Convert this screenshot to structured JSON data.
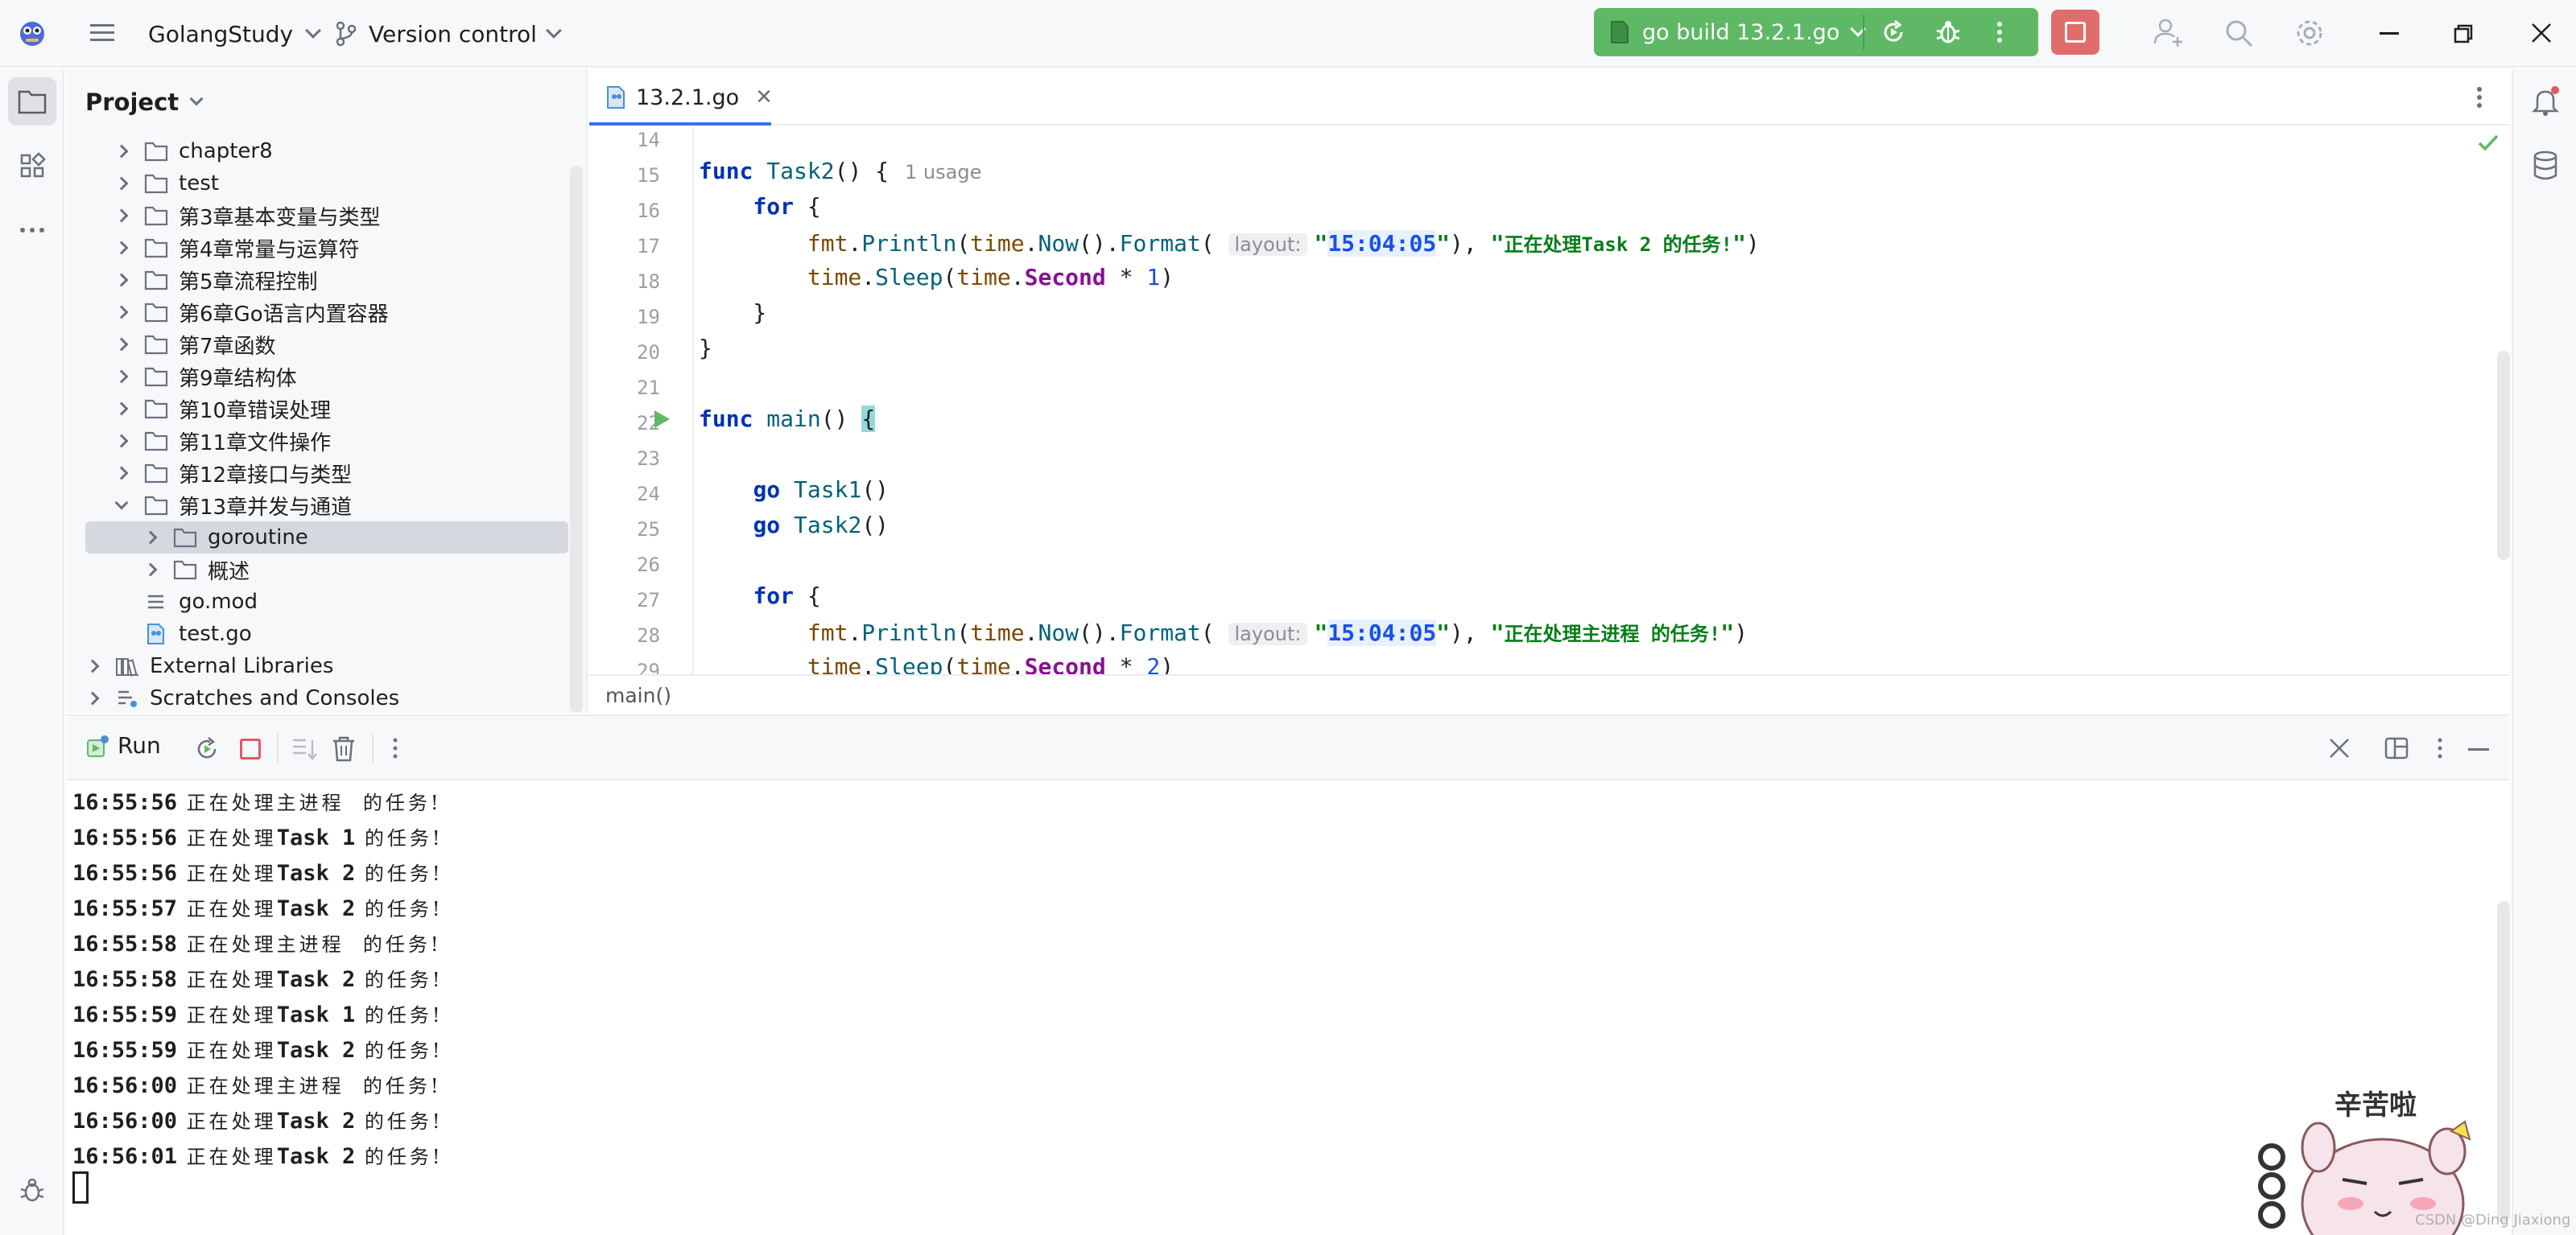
{
  "titlebar": {
    "project_name": "GolangStudy",
    "vcs_label": "Version control",
    "run_config": "go build 13.2.1.go"
  },
  "project_panel": {
    "title": "Project",
    "items": [
      {
        "label": "chapter8",
        "kind": "folder",
        "level": 1,
        "expanded": false
      },
      {
        "label": "test",
        "kind": "folder",
        "level": 1,
        "expanded": false
      },
      {
        "label": "第3章基本变量与类型",
        "kind": "folder",
        "level": 1,
        "expanded": false
      },
      {
        "label": "第4章常量与运算符",
        "kind": "folder",
        "level": 1,
        "expanded": false
      },
      {
        "label": "第5章流程控制",
        "kind": "folder",
        "level": 1,
        "expanded": false
      },
      {
        "label": "第6章Go语言内置容器",
        "kind": "folder",
        "level": 1,
        "expanded": false
      },
      {
        "label": "第7章函数",
        "kind": "folder",
        "level": 1,
        "expanded": false
      },
      {
        "label": "第9章结构体",
        "kind": "folder",
        "level": 1,
        "expanded": false
      },
      {
        "label": "第10章错误处理",
        "kind": "folder",
        "level": 1,
        "expanded": false
      },
      {
        "label": "第11章文件操作",
        "kind": "folder",
        "level": 1,
        "expanded": false
      },
      {
        "label": "第12章接口与类型",
        "kind": "folder",
        "level": 1,
        "expanded": false
      },
      {
        "label": "第13章并发与通道",
        "kind": "folder",
        "level": 1,
        "expanded": true
      },
      {
        "label": "goroutine",
        "kind": "folder",
        "level": 2,
        "expanded": false,
        "selected": true
      },
      {
        "label": "概述",
        "kind": "folder",
        "level": 2,
        "expanded": false
      },
      {
        "label": "go.mod",
        "kind": "mod",
        "level": 1
      },
      {
        "label": "test.go",
        "kind": "gofile",
        "level": 1
      },
      {
        "label": "External Libraries",
        "kind": "lib",
        "level": 0
      },
      {
        "label": "Scratches and Consoles",
        "kind": "scratch",
        "level": 0
      }
    ]
  },
  "editor": {
    "tab_name": "13.2.1.go",
    "breadcrumb": "main()",
    "line_numbers": [
      "14",
      "15",
      "16",
      "17",
      "18",
      "19",
      "20",
      "21",
      "22",
      "23",
      "24",
      "25",
      "26",
      "27",
      "28",
      "29"
    ],
    "usage_hint": "1 usage",
    "param_hint": "layout:",
    "time_format": "15:04:05",
    "msg_task2": "正在处理Task 2 的任务!",
    "msg_main": "正在处理主进程 的任务!"
  },
  "run_panel": {
    "title": "Run",
    "lines": [
      {
        "time": "16:55:56",
        "msg": " 正在处理主进程  的任务!"
      },
      {
        "time": "16:55:56",
        "msg": " 正在处理Task 1 的任务!"
      },
      {
        "time": "16:55:56",
        "msg": " 正在处理Task 2 的任务!"
      },
      {
        "time": "16:55:57",
        "msg": " 正在处理Task 2 的任务!"
      },
      {
        "time": "16:55:58",
        "msg": " 正在处理主进程  的任务!"
      },
      {
        "time": "16:55:58",
        "msg": " 正在处理Task 2 的任务!"
      },
      {
        "time": "16:55:59",
        "msg": " 正在处理Task 1 的任务!"
      },
      {
        "time": "16:55:59",
        "msg": " 正在处理Task 2 的任务!"
      },
      {
        "time": "16:56:00",
        "msg": " 正在处理主进程  的任务!"
      },
      {
        "time": "16:56:00",
        "msg": " 正在处理Task 2 的任务!"
      },
      {
        "time": "16:56:01",
        "msg": " 正在处理Task 2 的任务!"
      }
    ]
  },
  "sticker": {
    "text": "辛苦啦",
    "watermark": "CSDN @Ding Jiaxiong"
  },
  "colors": {
    "run_green": "#5fb865",
    "stop_red": "#e06c6c",
    "accent": "#3574f0",
    "keyword": "#0033b3",
    "string": "#067d17",
    "number": "#1750eb",
    "selection": "#d5d8de"
  },
  "icons": [
    "app-logo-icon",
    "hamburger-menu-icon",
    "branch-icon",
    "go-file-icon",
    "rerun-icon",
    "debug-icon",
    "more-vertical-icon",
    "stop-icon",
    "add-user-icon",
    "search-icon",
    "settings-icon",
    "minimize-icon",
    "restore-icon",
    "close-icon",
    "folder-icon",
    "structure-icon",
    "more-horizontal-icon",
    "bug-icon",
    "notifications-icon",
    "database-icon",
    "run-gutter-icon",
    "checkmark-icon"
  ]
}
